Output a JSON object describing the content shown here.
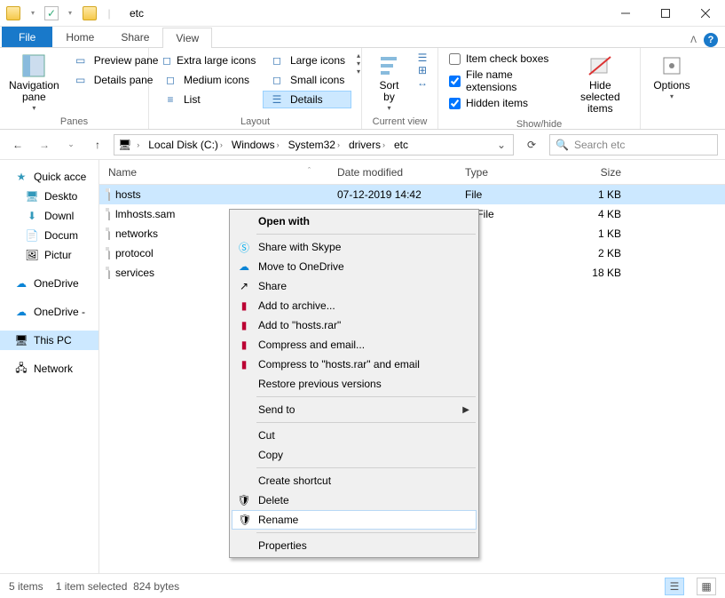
{
  "window": {
    "title": "etc"
  },
  "tabs": {
    "file": "File",
    "home": "Home",
    "share": "Share",
    "view": "View"
  },
  "ribbon": {
    "panes": {
      "nav_label": "Navigation\npane",
      "preview": "Preview pane",
      "details": "Details pane",
      "group_label": "Panes"
    },
    "layout": {
      "xl": "Extra large icons",
      "lg": "Large icons",
      "md": "Medium icons",
      "sm": "Small icons",
      "list": "List",
      "details": "Details",
      "group_label": "Layout"
    },
    "current": {
      "sort": "Sort\nby",
      "group_label": "Current view"
    },
    "showhide": {
      "chk1": "Item check boxes",
      "chk2": "File name extensions",
      "chk3": "Hidden items",
      "hide": "Hide selected\nitems",
      "group_label": "Show/hide"
    },
    "options": "Options"
  },
  "breadcrumbs": [
    "Local Disk (C:)",
    "Windows",
    "System32",
    "drivers",
    "etc"
  ],
  "search_placeholder": "Search etc",
  "nav_items": {
    "quick": "Quick acce",
    "desktop": "Deskto",
    "downloads": "Downl",
    "documents": "Docum",
    "pictures": "Pictur",
    "onedrive1": "OneDrive",
    "onedrive2": "OneDrive -",
    "thispc": "This PC",
    "network": "Network"
  },
  "columns": {
    "name": "Name",
    "date": "Date modified",
    "type": "Type",
    "size": "Size"
  },
  "files": [
    {
      "name": "hosts",
      "date": "07-12-2019 14:42",
      "type": "File",
      "size": "1 KB",
      "selected": true
    },
    {
      "name": "lmhosts.sam",
      "date": "",
      "type": "M File",
      "size": "4 KB"
    },
    {
      "name": "networks",
      "date": "",
      "type": "",
      "size": "1 KB"
    },
    {
      "name": "protocol",
      "date": "",
      "type": "",
      "size": "2 KB"
    },
    {
      "name": "services",
      "date": "",
      "type": "",
      "size": "18 KB"
    }
  ],
  "context_menu": {
    "open_with": "Open with",
    "skype": "Share with Skype",
    "onedrive": "Move to OneDrive",
    "share": "Share",
    "archive": "Add to archive...",
    "hostsrar": "Add to \"hosts.rar\"",
    "compress_email": "Compress and email...",
    "compress_hosts_email": "Compress to \"hosts.rar\" and email",
    "restore": "Restore previous versions",
    "sendto": "Send to",
    "cut": "Cut",
    "copy": "Copy",
    "shortcut": "Create shortcut",
    "delete": "Delete",
    "rename": "Rename",
    "properties": "Properties"
  },
  "status": {
    "count": "5 items",
    "selected": "1 item selected",
    "bytes": "824 bytes"
  }
}
